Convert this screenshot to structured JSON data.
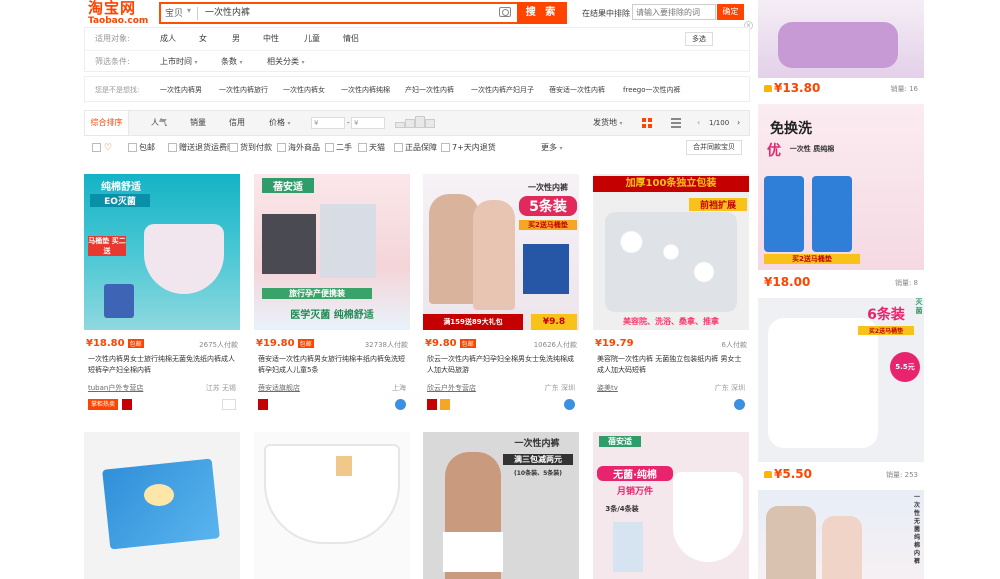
{
  "header": {
    "logo_cn": "淘宝网",
    "logo_en": "Taobao.com",
    "search_category": "宝贝",
    "search_value": "一次性内裤",
    "search_button": "搜 索",
    "exclude_label": "在结果中排除",
    "exclude_placeholder": "请输入要排除的词",
    "exclude_ok": "确定"
  },
  "filters": {
    "row1_label": "适用对象:",
    "row1_options": [
      "成人",
      "女",
      "男",
      "中性",
      "儿童",
      "情侣"
    ],
    "multi": "多选",
    "row2_label": "筛选条件:",
    "row2_options": [
      "上市时间",
      "条数",
      "相关分类"
    ]
  },
  "guess": {
    "label": "您是不是想找:",
    "items": [
      "一次性内裤男",
      "一次性内裤旅行",
      "一次性内裤女",
      "一次性内裤纯棉",
      "产妇一次性内裤",
      "一次性内裤产妇月子",
      "蓓安适一次性内裤",
      "freego一次性内裤"
    ]
  },
  "sortbar": {
    "default": "综合排序",
    "popularity": "人气",
    "sales": "销量",
    "credit": "信用",
    "price": "价格",
    "price_from": "¥",
    "price_to": "¥",
    "location": "发货地",
    "pager": "1/100"
  },
  "options": [
    "包邮",
    "赠送退货运费险",
    "货到付款",
    "海外商品",
    "二手",
    "天猫",
    "正品保障",
    "7+天内退货"
  ],
  "options_more": "更多",
  "merge": "合并同款宝贝",
  "products": [
    {
      "price": "¥18.80",
      "pay": "2675人付款",
      "title": "一次性内裤男女士旅行纯棉无菌免洗纸内裤成人短裤孕产妇全棉内裤",
      "shop": "tuban户外专营店",
      "loc": "江苏 无锡",
      "img_text1": "纯棉舒适",
      "img_text2": "EO灭菌",
      "img_text3": "马桶垫 买二送"
    },
    {
      "price": "¥19.80",
      "pay": "32738人付款",
      "title": "蓓安适一次性内裤男女旅行纯棉丰纸内裤免洗短裤孕妇成人儿童5条",
      "shop": "蓓安适旗舰店",
      "loc": "上海",
      "img_text1": "蓓安适",
      "img_text2": "旅行孕产便携装",
      "img_text3": "医学灭菌 纯棉舒适"
    },
    {
      "price": "¥9.80",
      "pay": "10626人付款",
      "title": "欣云一次性内裤产妇孕妇全棉男女士免洗纯棉成人加大码旅游",
      "shop": "欣云户外专营店",
      "loc": "广东 深圳",
      "img_text1": "一次性内裤",
      "img_text2": "5条装",
      "img_text3": "买2送马桶垫",
      "img_text4": "满159送89大礼包",
      "img_text5": "¥9.8"
    },
    {
      "price": "¥19.79",
      "pay": "6人付款",
      "title": "美容院一次性内裤 无菌独立包装纸内裤 男女士成人加大码短裤",
      "shop": "姿美tv",
      "loc": "广东 深圳",
      "img_text1": "加厚100条独立包装",
      "img_text2": "前裆扩展",
      "img_text3": "美容院、洗浴、桑拿、推拿"
    }
  ],
  "products_row2": [
    {
      "img_text1": ""
    },
    {
      "img_text1": ""
    },
    {
      "img_text1": "一次性内裤",
      "img_text2": "满三包减两元",
      "img_text3": "(10条装、5条装)"
    },
    {
      "img_text1": "蓓安适",
      "img_text2": "无菌·纯棉",
      "img_text3": "月销万件",
      "img_text4": "3条/4条装"
    }
  ],
  "sidebar": [
    {
      "price": "¥13.80",
      "sales": "销量: 16"
    },
    {
      "price": "¥18.00",
      "sales": "销量: 8",
      "img_text1": "免换洗",
      "img_text2": "优",
      "img_text3": "一次性 质纯棉",
      "img_text4": "买2送马桶垫"
    },
    {
      "price": "¥5.50",
      "sales": "销量: 253",
      "img_text1": "6条装",
      "img_text2": "买2送马桶垫",
      "img_text3": "灭菌",
      "img_text4": "5.5元"
    },
    {
      "img_text1": "一次性无菌纯棉内裤"
    }
  ],
  "colors": {
    "accent": "#ff4400",
    "price": "#ff4400"
  }
}
